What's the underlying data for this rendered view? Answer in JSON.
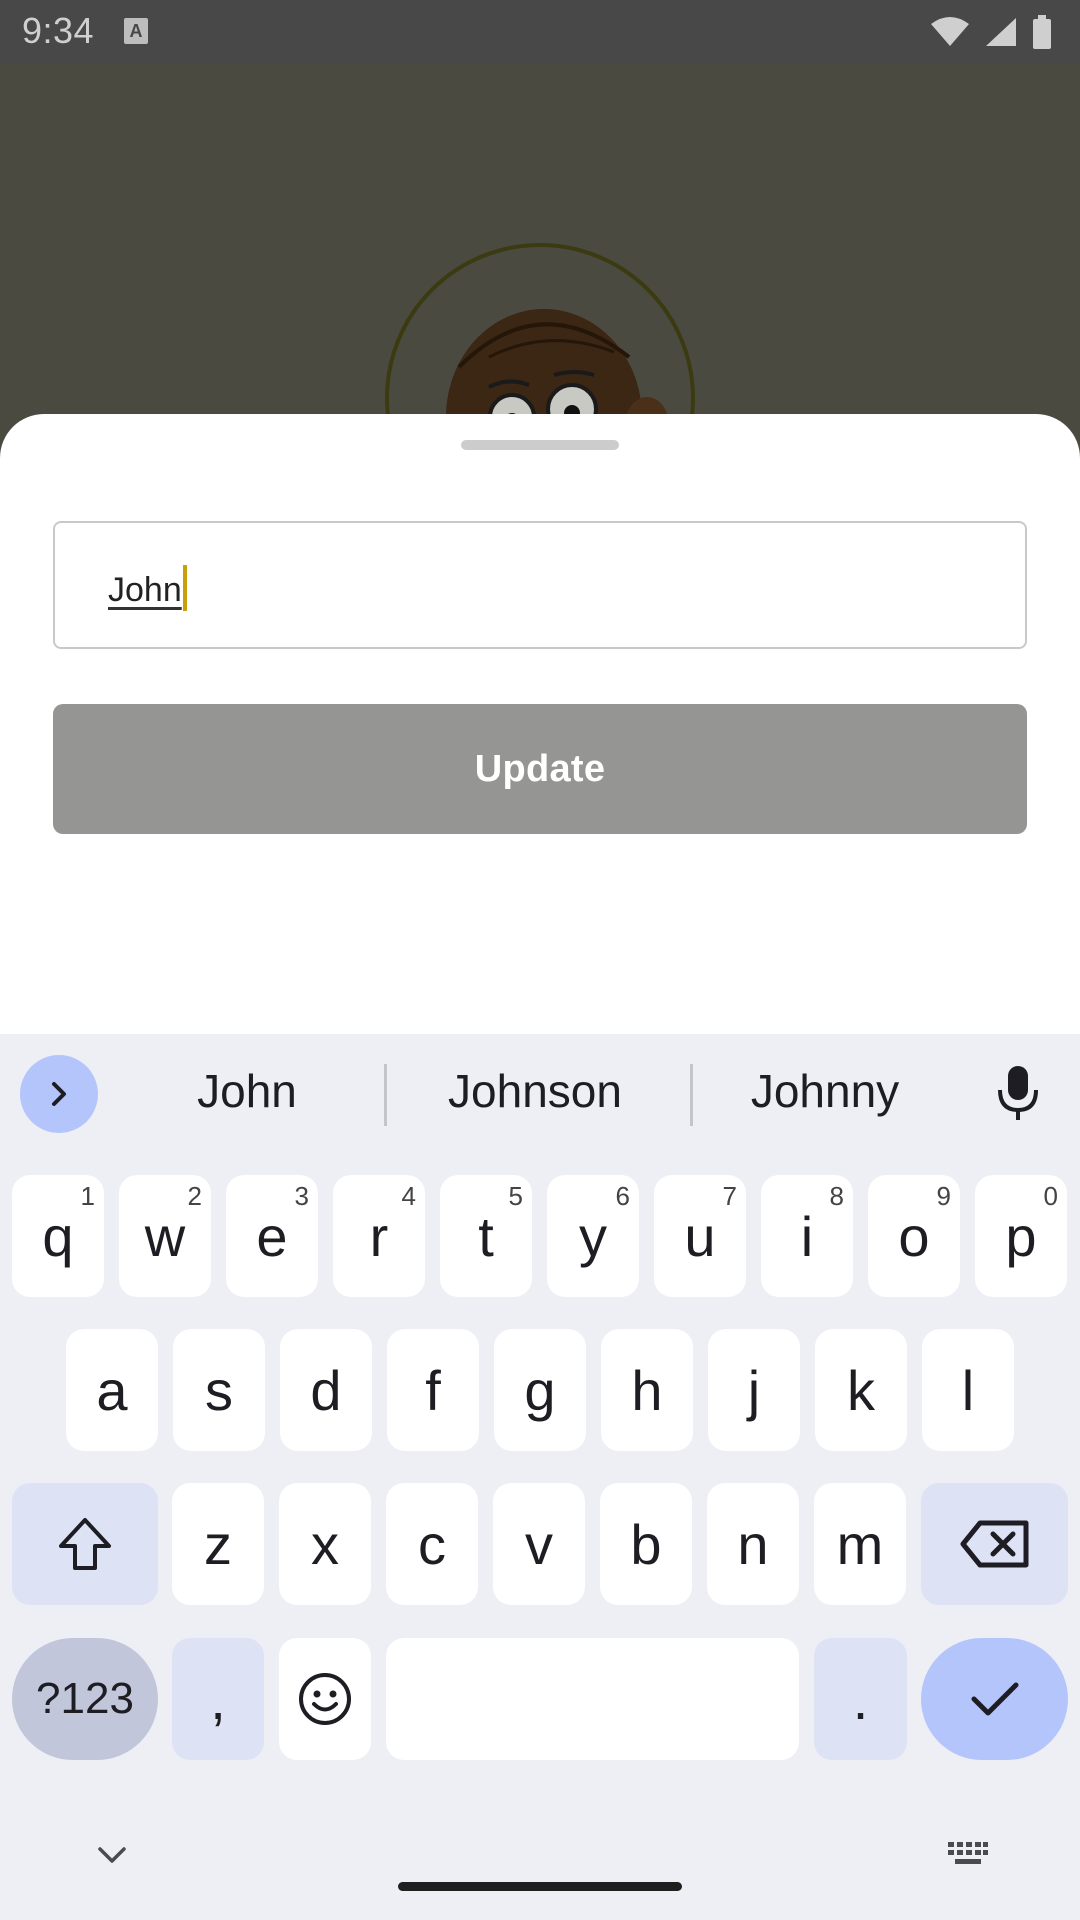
{
  "status_bar": {
    "time": "9:34",
    "notification_glyph": "A"
  },
  "sheet": {
    "name_value": "John",
    "update_label": "Update"
  },
  "keyboard": {
    "suggestions": [
      "John",
      "Johnson",
      "Johnny"
    ],
    "row1": [
      {
        "k": "q",
        "h": "1"
      },
      {
        "k": "w",
        "h": "2"
      },
      {
        "k": "e",
        "h": "3"
      },
      {
        "k": "r",
        "h": "4"
      },
      {
        "k": "t",
        "h": "5"
      },
      {
        "k": "y",
        "h": "6"
      },
      {
        "k": "u",
        "h": "7"
      },
      {
        "k": "i",
        "h": "8"
      },
      {
        "k": "o",
        "h": "9"
      },
      {
        "k": "p",
        "h": "0"
      }
    ],
    "row2": [
      "a",
      "s",
      "d",
      "f",
      "g",
      "h",
      "j",
      "k",
      "l"
    ],
    "row3": [
      "z",
      "x",
      "c",
      "v",
      "b",
      "n",
      "m"
    ],
    "symbols_label": "?123",
    "comma": ",",
    "period": ".",
    "accent_color": "#b3c5fb",
    "icons": [
      "chevron-right-icon",
      "microphone-icon",
      "shift-icon",
      "backspace-icon",
      "emoji-icon",
      "checkmark-icon",
      "chevron-down-icon",
      "keyboard-icon"
    ]
  }
}
